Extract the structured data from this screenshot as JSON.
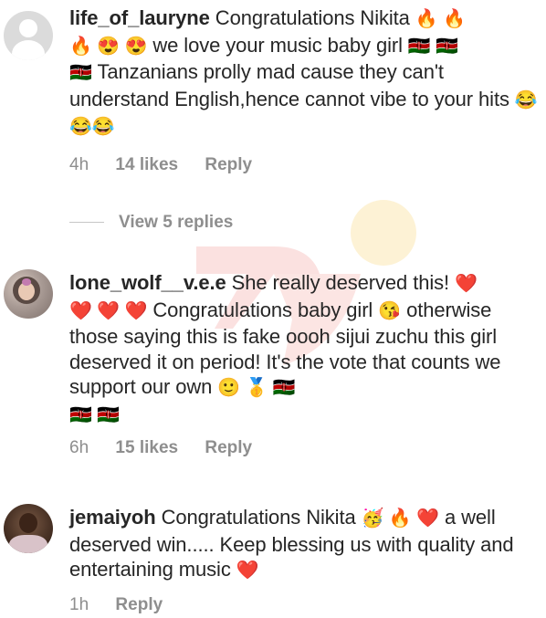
{
  "comments": [
    {
      "username": "life_of_lauryne",
      "text_1": "Congratulations Nikita",
      "emoji_1": "🔥 🔥",
      "emoji_2": "🔥 😍 😍",
      "text_2": "we love your music baby girl",
      "emoji_3": "🇰🇪 🇰🇪",
      "emoji_4": "🇰🇪",
      "text_3": "Tanzanians prolly mad cause they can't understand English,hence cannot vibe to your hits",
      "emoji_5": "😂😂😂",
      "time": "4h",
      "likes": "14 likes",
      "reply": "Reply",
      "view_replies": "View 5 replies"
    },
    {
      "username": "lone_wolf__v.e.e",
      "text_1": "She really deserved this!",
      "emoji_1": "❤️",
      "emoji_2": "❤️ ❤️ ❤️",
      "text_2": "Congratulations baby girl",
      "emoji_3": "😘",
      "text_3": "otherwise those saying this is fake oooh sijui zuchu this girl deserved it on period! It's the vote that counts we support our own",
      "emoji_4": "🙂 🥇 🇰🇪",
      "emoji_5": "🇰🇪 🇰🇪",
      "time": "6h",
      "likes": "15 likes",
      "reply": "Reply"
    },
    {
      "username": "jemaiyoh",
      "text_1": "Congratulations Nikita",
      "emoji_1": "🥳 🔥 ❤️",
      "text_2": "a well deserved win..... Keep blessing us with quality and entertaining music",
      "emoji_2": "❤️",
      "time": "1h",
      "reply": "Reply"
    }
  ],
  "colors": {
    "text": "#262626",
    "meta": "#8e8e8e",
    "watermark_red": "#e8453c",
    "watermark_yellow": "#f5c542"
  }
}
